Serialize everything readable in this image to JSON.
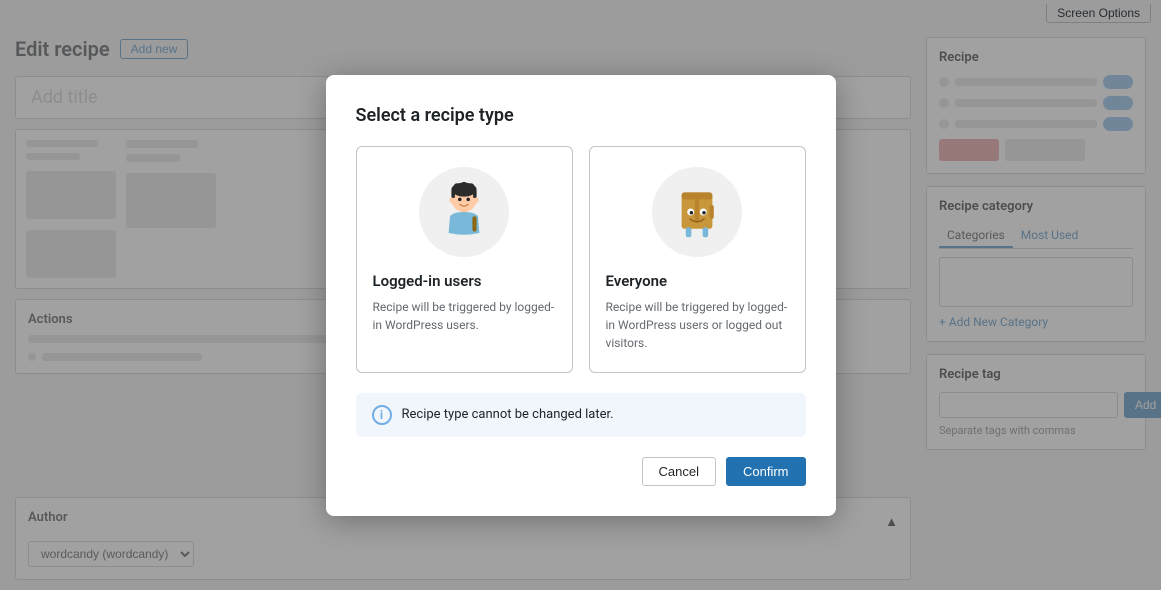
{
  "topbar": {
    "screen_options_label": "Screen Options"
  },
  "header": {
    "page_title": "Edit recipe",
    "add_new_label": "Add new"
  },
  "editor": {
    "title_placeholder": "Add title"
  },
  "actions": {
    "label": "Actions"
  },
  "author": {
    "label": "Author",
    "select_value": "wordcandy (wordcandy)"
  },
  "sidebar": {
    "recipe_panel_title": "Recipe",
    "category_panel_title": "Recipe category",
    "category_tabs": [
      "Categories",
      "Most Used"
    ],
    "add_category_link": "+ Add New Category",
    "tag_panel_title": "Recipe tag",
    "tag_placeholder": "",
    "tag_add_label": "Add",
    "tag_hint": "Separate tags with commas"
  },
  "modal": {
    "title": "Select a recipe type",
    "logged_in_title": "Logged-in users",
    "logged_in_desc": "Recipe will be triggered by logged-in WordPress users.",
    "everyone_title": "Everyone",
    "everyone_desc": "Recipe will be triggered by logged-in WordPress users or logged out visitors.",
    "notice_text": "Recipe type cannot be changed later.",
    "cancel_label": "Cancel",
    "confirm_label": "Confirm"
  }
}
